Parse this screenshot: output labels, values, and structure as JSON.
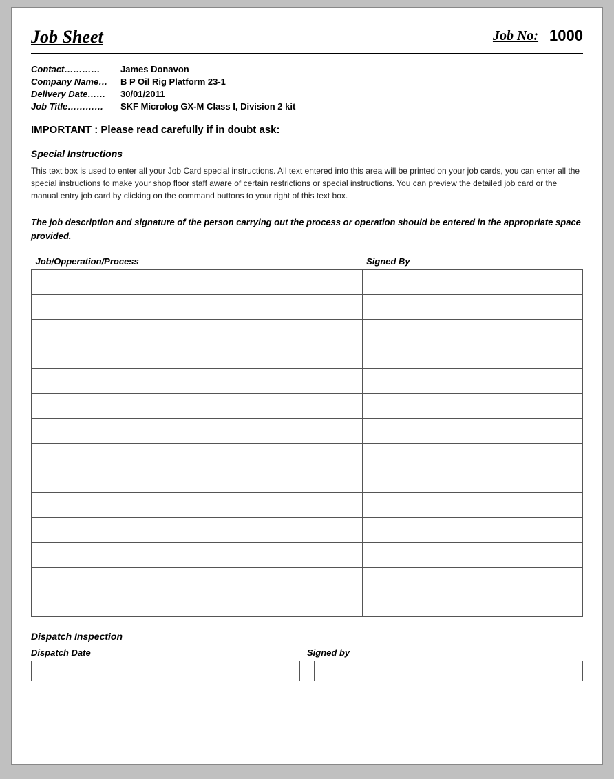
{
  "header": {
    "title": "Job Sheet",
    "job_no_label": "Job No:",
    "job_no_value": "1000"
  },
  "info": {
    "contact_label": "Contact…………",
    "contact_value": "James Donavon",
    "company_label": "Company Name…",
    "company_value": "B P Oil Rig Platform 23-1",
    "delivery_label": "Delivery Date……",
    "delivery_value": "30/01/2011",
    "job_title_label": "Job Title…………",
    "job_title_value": "SKF Microlog GX-M Class I, Division 2 kit"
  },
  "important_notice": "IMPORTANT : Please read carefully if in doubt ask:",
  "special_instructions": {
    "title": "Special Instructions",
    "text": "This text box is used to enter all your Job Card special instructions. All text entered into this area will be printed on your job cards, you can enter all the special instructions to make your shop floor staff aware of certain restrictions or special instructions. You can preview the detailed job card or the manual entry job card by clicking on the command buttons to your right of this text box."
  },
  "job_desc_note": "The job description and signature of the person carrying out the process or operation should be entered in the appropriate space provided.",
  "table": {
    "col1_header": "Job/Opperation/Process",
    "col2_header": "Signed By",
    "rows": 14
  },
  "dispatch": {
    "title": "Dispatch Inspection",
    "date_label": "Dispatch Date",
    "signed_label": "Signed by"
  }
}
